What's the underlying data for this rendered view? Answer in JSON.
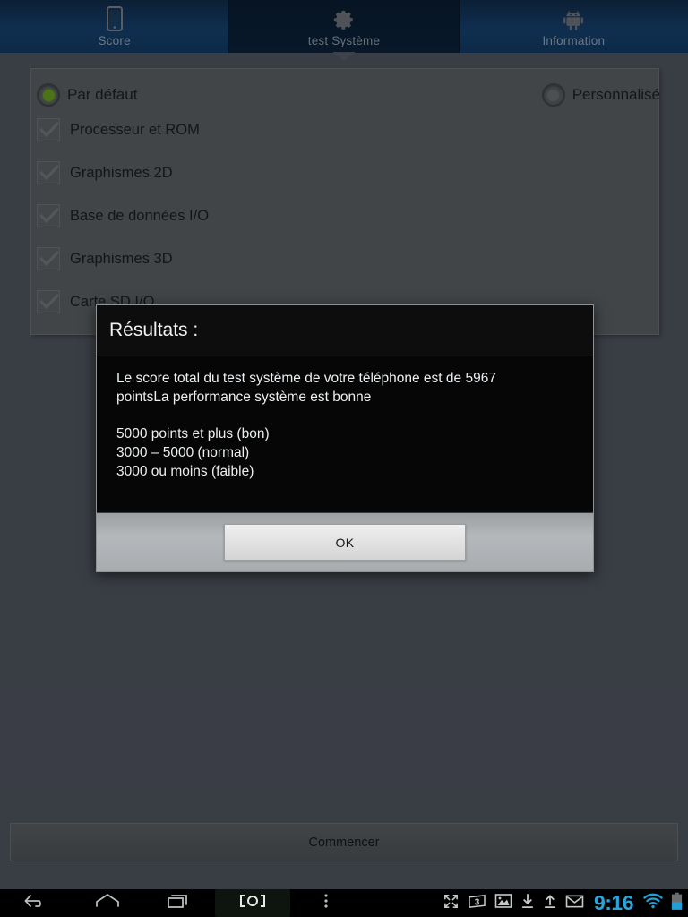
{
  "tabs": [
    {
      "label": "Score",
      "icon": "phone-icon",
      "active": false
    },
    {
      "label": "test Système",
      "icon": "gear-icon",
      "active": true
    },
    {
      "label": "Information",
      "icon": "android-robot-icon",
      "active": false
    }
  ],
  "options": {
    "default_radio": {
      "label": "Par défaut",
      "selected": true
    },
    "custom_radio": {
      "label": "Personnalisé",
      "selected": false
    },
    "checkboxes": [
      {
        "label": "Processeur et ROM",
        "checked": true
      },
      {
        "label": "Graphismes 2D",
        "checked": true
      },
      {
        "label": "Base de données I/O",
        "checked": true
      },
      {
        "label": "Graphismes 3D",
        "checked": true
      },
      {
        "label": "Carte SD I/O",
        "checked": true
      }
    ]
  },
  "start_button": {
    "label": "Commencer"
  },
  "dialog": {
    "title": "Résultats :",
    "line1": "Le score total du test système de votre téléphone est de 5967",
    "line2": "pointsLa performance système est bonne",
    "scale": [
      "5000 points et plus (bon)",
      "3000 – 5000 (normal)",
      "3000 ou moins (faible)"
    ],
    "ok_label": "OK"
  },
  "navbar": {
    "back": "back-icon",
    "home": "home-icon",
    "recents": "recents-icon",
    "screenshot": "screenshot-capture-icon",
    "overflow": "overflow-menu-icon"
  },
  "statusbar": {
    "clock": "9:16",
    "badge_count": "3",
    "icons": [
      "fullscreen-icon",
      "badge-3-icon",
      "image-icon",
      "download-icon",
      "upload-icon",
      "mail-icon",
      "wifi-icon",
      "battery-icon"
    ]
  },
  "colors": {
    "accent_green": "#6aa121",
    "clock_blue": "#2aa5dc",
    "background": "#50555f",
    "panel": "#5b6063",
    "dialog": "#0a0a0a"
  }
}
